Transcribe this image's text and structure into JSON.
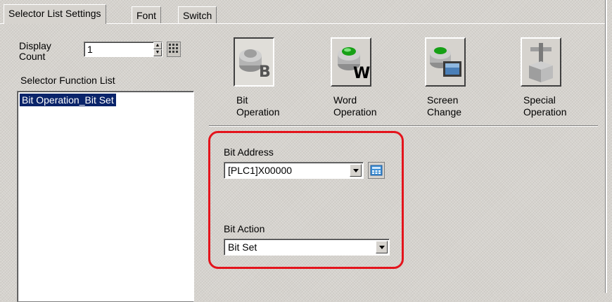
{
  "tabs": [
    {
      "label": "Selector List Settings",
      "active": true
    },
    {
      "label": "Font",
      "active": false
    },
    {
      "label": "Switch",
      "active": false
    }
  ],
  "display_count": {
    "label_line1": "Display",
    "label_line2": "Count",
    "value": "1"
  },
  "selector_function_list": {
    "label": "Selector Function List",
    "items": [
      "Bit Operation_Bit Set"
    ],
    "selected_index": 0
  },
  "function_buttons": [
    {
      "line1": "Bit",
      "line2": "Operation",
      "icon": "bit-operation-icon",
      "pressed": true
    },
    {
      "line1": "Word",
      "line2": "Operation",
      "icon": "word-operation-icon",
      "pressed": false
    },
    {
      "line1": "Screen",
      "line2": "Change",
      "icon": "screen-change-icon",
      "pressed": false
    },
    {
      "line1": "Special",
      "line2": "Operation",
      "icon": "special-operation-icon",
      "pressed": false
    }
  ],
  "bit_address": {
    "label": "Bit Address",
    "value": "[PLC1]X00000"
  },
  "bit_action": {
    "label": "Bit Action",
    "value": "Bit Set"
  },
  "colors": {
    "highlight": "#e4141c",
    "selection": "#0a246a",
    "face": "#d6d3ce"
  }
}
